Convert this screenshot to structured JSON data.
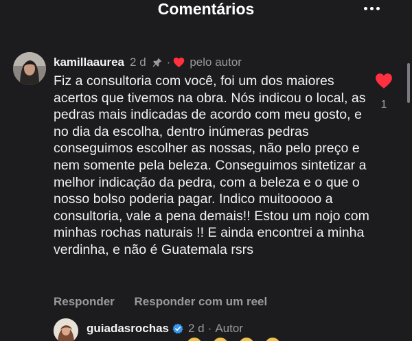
{
  "header": {
    "title": "Comentários",
    "more_icon": "more-horizontal-icon"
  },
  "comment": {
    "username": "kamillaaurea",
    "time": "2 d",
    "pinned_icon": "pin-icon",
    "separator": "·",
    "author_liked_label": "pelo autor",
    "text": "Fiz a consultoria com você, foi um dos maiores acertos que tivemos na obra. Nós indicou o local, as pedras mais indicadas de acordo com meu gosto, e no dia da escolha, dentro inúmeras pedras conseguimos escolher as nossas, não pelo preço e nem somente pela beleza. Conseguimos sintetizar a melhor indicação da pedra, com a beleza e o que o nosso bolso poderia pagar. Indico muitooooo a consultoria, vale a pena demais!! Estou um nojo com minhas rochas naturais !! E ainda encontrei a minha verdinha, e não é Guatemala rsrs",
    "like_count": "1",
    "liked": true,
    "reply_label": "Responder",
    "reply_reel_label": "Responder com um reel"
  },
  "reply": {
    "username": "guiadasrochas",
    "verified": true,
    "time": "2 d",
    "separator": "·",
    "author_tag": "Autor"
  },
  "colors": {
    "background": "#1c1c1e",
    "text": "#f2f2f2",
    "muted": "#9a9a9e",
    "like_red": "#ff3040",
    "verified_blue": "#3897f0"
  }
}
